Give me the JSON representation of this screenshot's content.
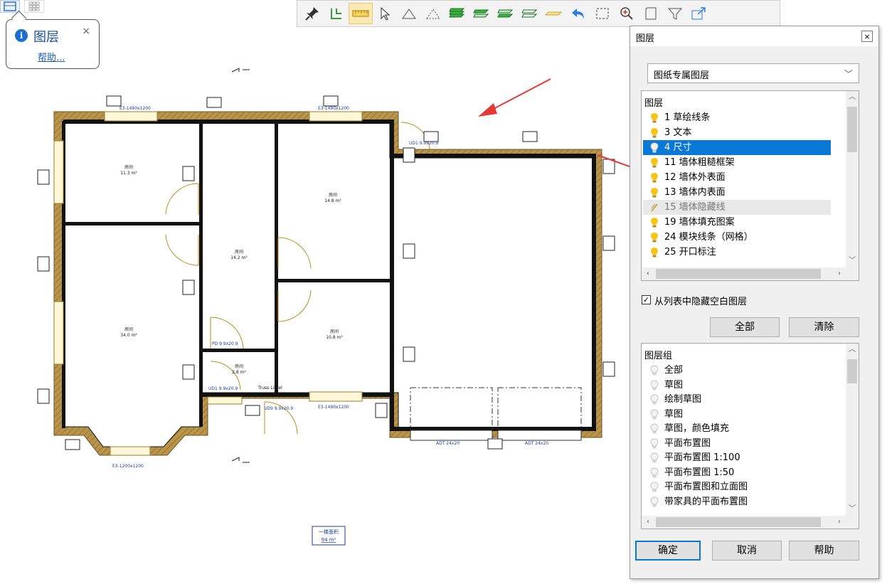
{
  "help_bubble": {
    "title": "图层",
    "link": "帮助...",
    "close": "×"
  },
  "toolbar": {
    "icons": [
      "pin-icon",
      "snap-icon",
      "ruler-icon",
      "select-arrow-icon",
      "triangle-icon",
      "triangle-dashed-icon",
      "layer-stack-green-icon",
      "layer-stack-green-2-icon",
      "layer-stack-green-3-icon",
      "layer-outline-icon",
      "eraser-icon",
      "undo-icon",
      "zoom-frame-icon",
      "zoom-in-icon",
      "page-icon",
      "filter-icon",
      "export-icon"
    ],
    "active": "ruler-icon"
  },
  "drawing": {
    "rooms": [
      {
        "name": "房间",
        "area": "11.3 m²"
      },
      {
        "name": "房间",
        "area": "14.8 m²"
      },
      {
        "name": "房间",
        "area": "14.2 m²"
      },
      {
        "name": "房间",
        "area": "34.0 m²"
      },
      {
        "name": "房间",
        "area": "10.8 m²"
      },
      {
        "name": "房间",
        "area": "2.8 m²"
      }
    ],
    "window_labels": [
      "E3-1490x1200",
      "E3-1490x1200",
      "E3-1490x1200",
      "E3-1200x1200"
    ],
    "door_labels": [
      "PD 9.9x20.9",
      "UD1 9.9x20.9",
      "UD9 9.9x20.9",
      "UD1 9.9x20.9"
    ],
    "lintel_label": "Truss Lintel",
    "garage_labels": [
      "ADT 24x20",
      "ADT 24x20"
    ],
    "area_box": {
      "label": "一楼面积",
      "value": "94 m²"
    }
  },
  "dialog": {
    "title": "图层",
    "close": "×",
    "combo_value": "图纸专属图层",
    "layers_header": "图层",
    "layers": [
      {
        "label": "1 草绘线条",
        "state": "on"
      },
      {
        "label": "3 文本",
        "state": "on"
      },
      {
        "label": "4 尺寸",
        "state": "off",
        "selected": true
      },
      {
        "label": "11 墙体粗糙框架",
        "state": "on"
      },
      {
        "label": "12 墙体外表面",
        "state": "on"
      },
      {
        "label": "13 墙体内表面",
        "state": "on"
      },
      {
        "label": "15 墙体隐藏线",
        "state": "hidden"
      },
      {
        "label": "19 墙体填充图案",
        "state": "on"
      },
      {
        "label": "24 模块线条（网格）",
        "state": "on"
      },
      {
        "label": "25 开口标注",
        "state": "on"
      }
    ],
    "hide_empty_label": "从列表中隐藏空白图层",
    "hide_empty_checked": true,
    "all_button": "全部",
    "clear_button": "清除",
    "groups_header": "图层组",
    "groups": [
      "全部",
      "草图",
      "绘制草图",
      "草图",
      "草图，颜色填充",
      "平面布置图",
      "平面布置图 1:100",
      "平面布置图 1:50",
      "平面布置图和立面图",
      "带家具的平面布置图"
    ],
    "ok_button": "确定",
    "cancel_button": "取消",
    "help_button": "帮助"
  },
  "colors": {
    "selection": "#0a78d7",
    "bulb_on": "#f5c518",
    "arrow": "#e53935",
    "wall_fill": "#b8954a"
  }
}
